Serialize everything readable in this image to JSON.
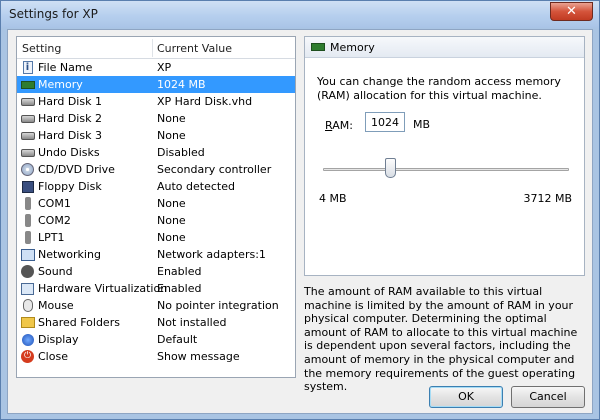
{
  "window": {
    "title": "Settings for XP",
    "close_glyph": "✕"
  },
  "list": {
    "headers": {
      "setting": "Setting",
      "value": "Current Value"
    },
    "items": [
      {
        "icon": "file-info-icon",
        "name": "File Name",
        "value": "XP"
      },
      {
        "icon": "memory-icon",
        "name": "Memory",
        "value": "1024 MB",
        "selected": true
      },
      {
        "icon": "hard-disk-icon",
        "name": "Hard Disk 1",
        "value": "XP Hard Disk.vhd"
      },
      {
        "icon": "hard-disk-icon",
        "name": "Hard Disk 2",
        "value": "None"
      },
      {
        "icon": "hard-disk-icon",
        "name": "Hard Disk 3",
        "value": "None"
      },
      {
        "icon": "undo-disk-icon",
        "name": "Undo Disks",
        "value": "Disabled"
      },
      {
        "icon": "cd-dvd-icon",
        "name": "CD/DVD Drive",
        "value": "Secondary controller"
      },
      {
        "icon": "floppy-icon",
        "name": "Floppy Disk",
        "value": "Auto detected"
      },
      {
        "icon": "serial-port-icon",
        "name": "COM1",
        "value": "None"
      },
      {
        "icon": "serial-port-icon",
        "name": "COM2",
        "value": "None"
      },
      {
        "icon": "parallel-port-icon",
        "name": "LPT1",
        "value": "None"
      },
      {
        "icon": "network-icon",
        "name": "Networking",
        "value": "Network adapters:1"
      },
      {
        "icon": "sound-icon",
        "name": "Sound",
        "value": "Enabled"
      },
      {
        "icon": "hardware-virtualization-icon",
        "name": "Hardware Virtualization",
        "value": "Enabled"
      },
      {
        "icon": "mouse-icon",
        "name": "Mouse",
        "value": "No pointer integration"
      },
      {
        "icon": "shared-folder-icon",
        "name": "Shared Folders",
        "value": "Not installed"
      },
      {
        "icon": "display-icon",
        "name": "Display",
        "value": "Default"
      },
      {
        "icon": "close-power-icon",
        "name": "Close",
        "value": "Show message"
      }
    ]
  },
  "panel": {
    "title": "Memory",
    "description": "You can change the random access memory (RAM) allocation for this virtual machine.",
    "ram_label_prefix": "R",
    "ram_label_rest": "AM:",
    "ram_value": "1024",
    "ram_unit": "MB",
    "slider_min_label": "4 MB",
    "slider_max_label": "3712 MB",
    "slider_fraction": 0.276
  },
  "note": "The amount of RAM available to this virtual machine is limited by the amount of RAM in your physical computer. Determining the optimal amount of RAM to allocate to this virtual machine is dependent upon several factors, including the amount of memory in the physical computer and the memory requirements of the guest operating system.",
  "buttons": {
    "ok": "OK",
    "cancel": "Cancel"
  }
}
